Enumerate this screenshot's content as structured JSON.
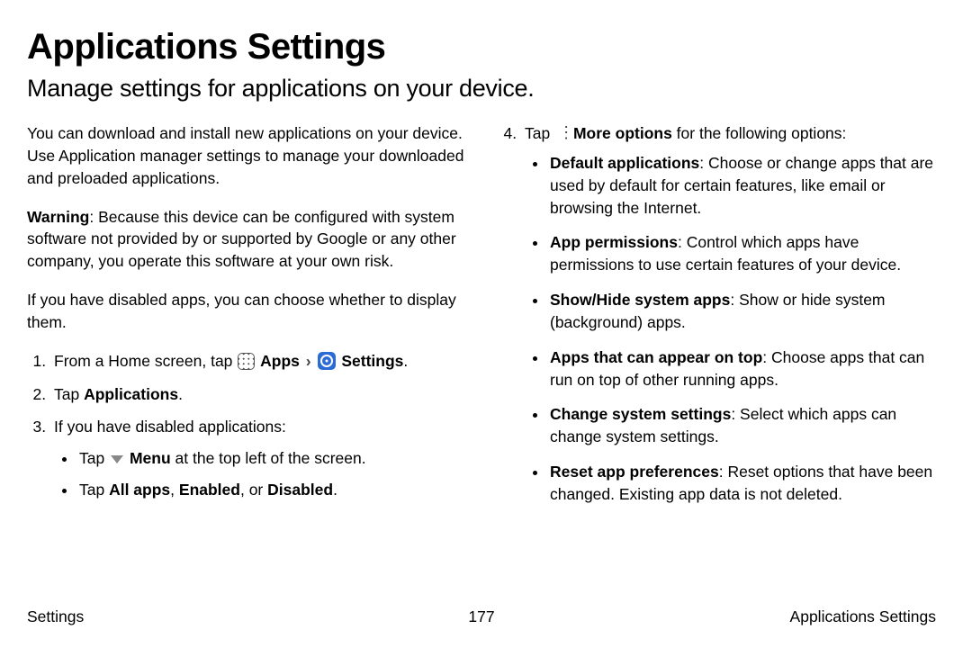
{
  "title": "Applications Settings",
  "subtitle": "Manage settings for applications on your device.",
  "intro": "You can download and install new applications on your device. Use Application manager settings to manage your downloaded and preloaded applications.",
  "warning_label": "Warning",
  "warning_text": ": Because this device can be configured with system software not provided by or supported by Google or any other company, you operate this software at your own risk.",
  "disabled_note": "If you have disabled apps, you can choose whether to display them.",
  "step1_pre": "From a Home screen, tap ",
  "step1_apps": "Apps",
  "step1_settings": "Settings",
  "step2_pre": "Tap ",
  "step2_bold": "Applications",
  "step3_text": "If you have disabled applications:",
  "step3a_pre": "Tap ",
  "step3a_bold": "Menu",
  "step3a_post": " at the top left of the screen.",
  "step3b_pre": "Tap ",
  "step3b_bold1": "All apps",
  "step3b_sep1": ", ",
  "step3b_bold2": "Enabled",
  "step3b_sep2": ", or ",
  "step3b_bold3": "Disabled",
  "step4_pre": "Tap ",
  "step4_bold": "More options",
  "step4_post": " for the following options:",
  "opts": {
    "default_apps_t": "Default applications",
    "default_apps_d": ": Choose or change apps that are used by default for certain features, like email or browsing the Internet.",
    "app_perm_t": "App permissions",
    "app_perm_d": ": Control which apps have permissions to use certain features of your device.",
    "showhide_t": "Show/Hide system apps",
    "showhide_d": ": Show or hide system (background) apps.",
    "ontop_t": "Apps that can appear on top",
    "ontop_d": ": Choose apps that can run on top of other running apps.",
    "changesys_t": "Change system settings",
    "changesys_d": ": Select which apps can change system settings.",
    "reset_t": "Reset app preferences",
    "reset_d": ": Reset options that have been changed. Existing app data is not deleted."
  },
  "footer": {
    "left": "Settings",
    "center": "177",
    "right": "Applications Settings"
  }
}
